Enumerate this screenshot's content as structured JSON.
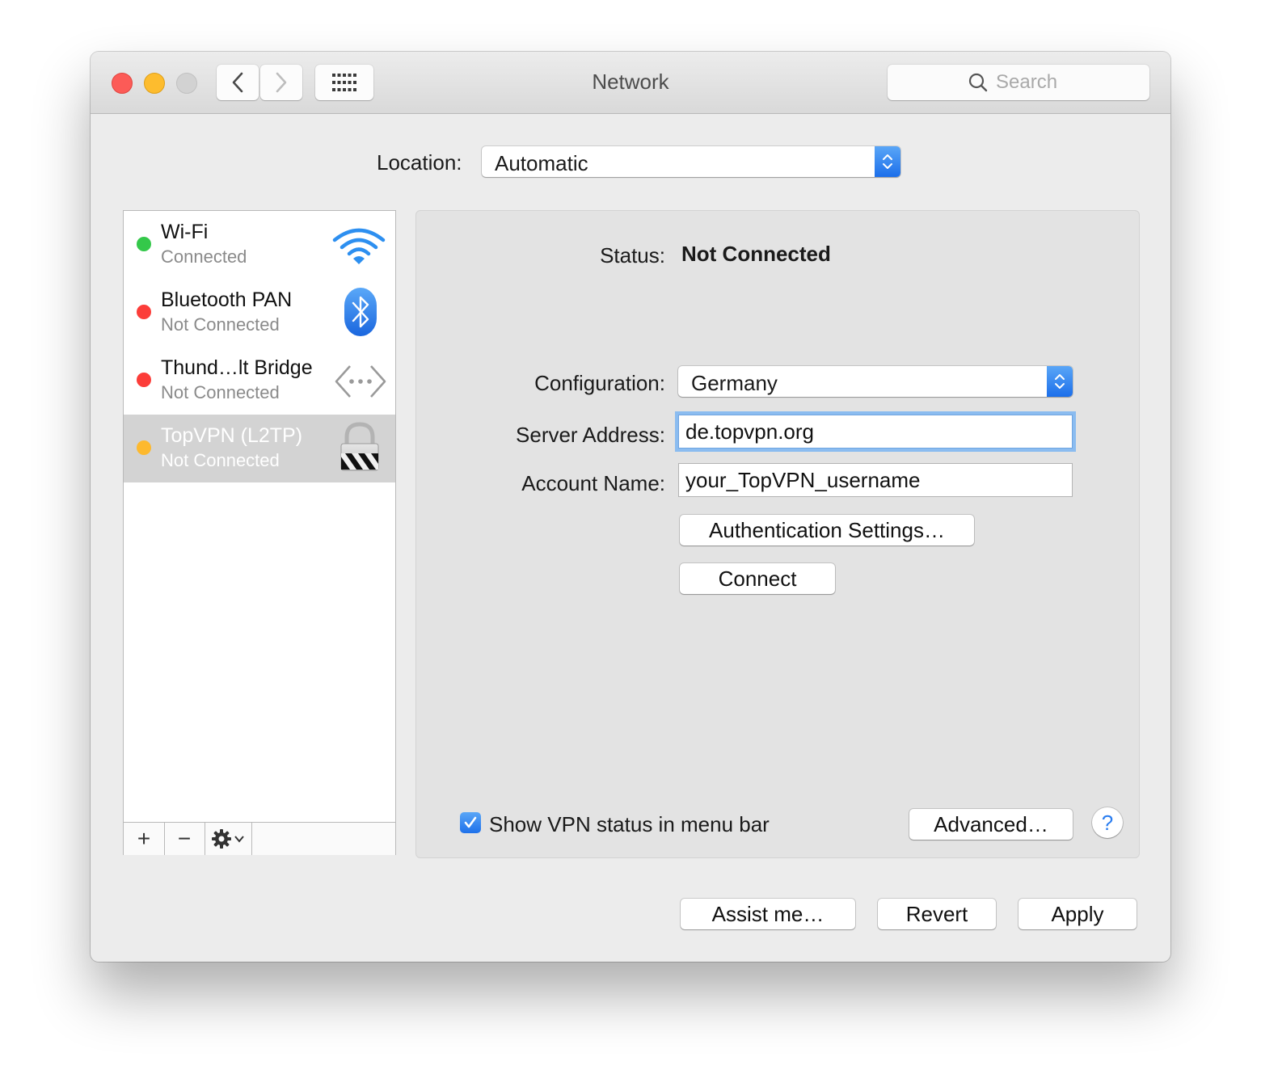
{
  "window": {
    "title": "Network"
  },
  "toolbar": {
    "search_placeholder": "Search"
  },
  "location": {
    "label": "Location:",
    "value": "Automatic"
  },
  "services": [
    {
      "name": "Wi-Fi",
      "status": "Connected",
      "dot_color": "#34c84a",
      "icon": "wifi-icon"
    },
    {
      "name": "Bluetooth PAN",
      "status": "Not Connected",
      "dot_color": "#fc3d39",
      "icon": "bluetooth-icon"
    },
    {
      "name": "Thund…lt Bridge",
      "status": "Not Connected",
      "dot_color": "#fc3d39",
      "icon": "thunderbolt-bridge-icon"
    },
    {
      "name": "TopVPN (L2TP)",
      "status": "Not Connected",
      "dot_color": "#fdb92e",
      "icon": "vpn-lock-icon",
      "selected": true
    }
  ],
  "sidebar_controls": {
    "add": "+",
    "remove": "−"
  },
  "detail": {
    "status_label": "Status:",
    "status_value": "Not Connected",
    "configuration_label": "Configuration:",
    "configuration_value": "Germany",
    "server_label": "Server Address:",
    "server_value": "de.topvpn.org",
    "account_label": "Account Name:",
    "account_value": "your_TopVPN_username",
    "auth_button": "Authentication Settings…",
    "connect_button": "Connect",
    "show_status_label": "Show VPN status in menu bar",
    "show_status_checked": true,
    "advanced_button": "Advanced…",
    "help_button": "?"
  },
  "footer": {
    "assist": "Assist me…",
    "revert": "Revert",
    "apply": "Apply"
  },
  "colors": {
    "accent": "#1c6fea",
    "selection": "#d3d3d3",
    "background": "#ececec"
  }
}
